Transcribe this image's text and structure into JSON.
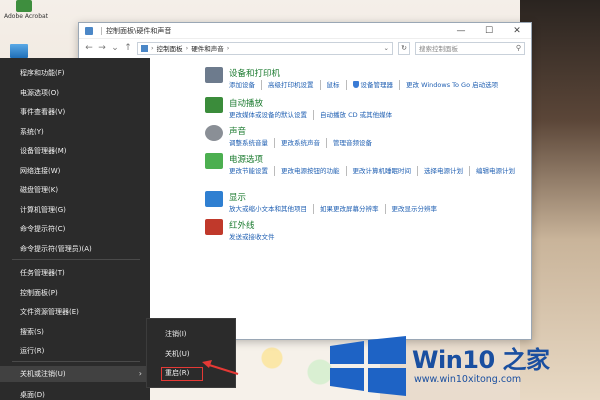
{
  "desktop": {
    "icon_label": "Adobe Acrobat"
  },
  "window": {
    "title": "控制面板\\硬件和声音",
    "controls": [
      "—",
      "☐",
      "✕"
    ],
    "address": {
      "segments": [
        "控制面板",
        "硬件和声音"
      ]
    },
    "search_placeholder": "搜索控制面板"
  },
  "categories": [
    {
      "title": "设备和打印机",
      "icon_color": "#6d7b8d",
      "links": [
        "添加设备",
        "高级打印机设置",
        "鼠标",
        "设备管理器",
        "更改 Windows To Go 启动选项"
      ]
    },
    {
      "title": "自动播放",
      "icon_color": "#3b8c3b",
      "links": [
        "更改媒体或设备的默认设置",
        "自动播放 CD 或其他媒体"
      ]
    },
    {
      "title": "声音",
      "icon_color": "#8a8f96",
      "links": [
        "调整系统音量",
        "更改系统声音",
        "管理音频设备"
      ]
    },
    {
      "title": "电源选项",
      "icon_color": "#4caf50",
      "links": [
        "更改节能设置",
        "更改电源按钮的功能",
        "更改计算机睡眠时间",
        "选择电源计划",
        "编辑电源计划"
      ]
    },
    {
      "title": "显示",
      "icon_color": "#2f7fd1",
      "links": [
        "放大或缩小文本和其他项目",
        "如果更改屏幕分辨率",
        "更改显示分辨率"
      ]
    },
    {
      "title": "红外线",
      "icon_color": "#c0392b",
      "links": [
        "发送或接收文件"
      ]
    }
  ],
  "winx_menu": {
    "items": [
      "程序和功能(F)",
      "电源选项(O)",
      "事件查看器(V)",
      "系统(Y)",
      "设备管理器(M)",
      "网络连接(W)",
      "磁盘管理(K)",
      "计算机管理(G)",
      "命令提示符(C)",
      "命令提示符(管理员)(A)",
      "任务管理器(T)",
      "控制面板(P)",
      "文件资源管理器(E)",
      "搜索(S)",
      "运行(R)",
      "关机或注销(U)",
      "桌面(D)"
    ],
    "submenu_arrow": "›"
  },
  "submenu": {
    "items": [
      "注销(I)",
      "关机(U)",
      "重启(R)"
    ],
    "highlight_color": "#e53935"
  },
  "watermark": {
    "title": "Win10 之家",
    "url": "www.win10xitong.com",
    "brand_color": "#1a4fa0"
  }
}
